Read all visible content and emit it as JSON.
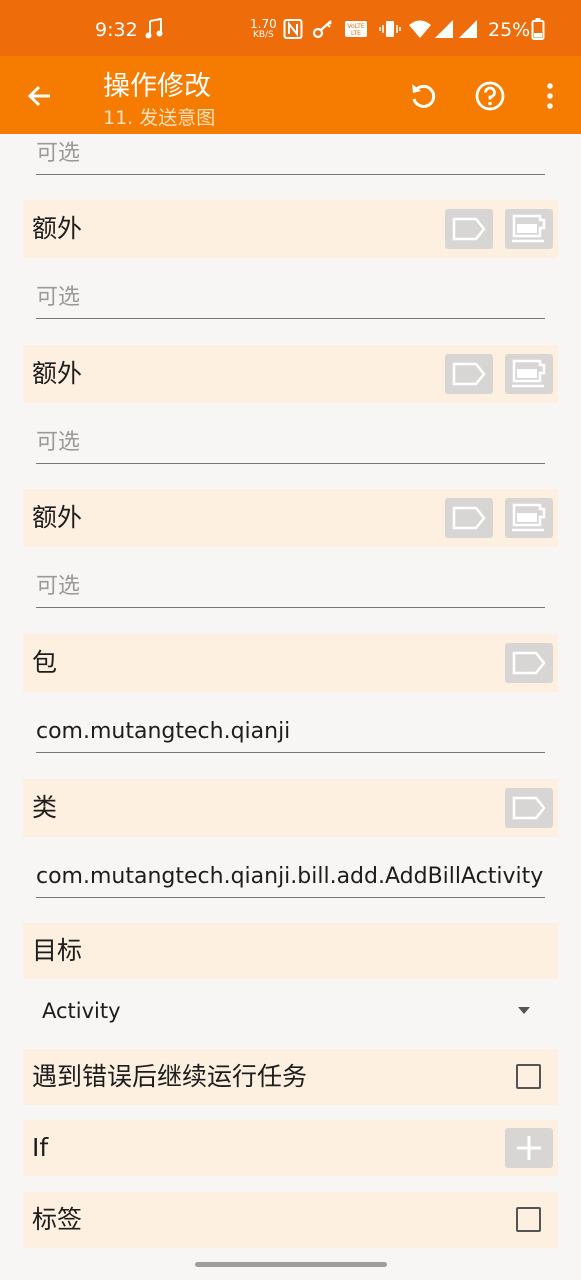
{
  "status": {
    "time": "9:32",
    "net_speed_value": "1.70",
    "net_speed_unit": "KB/S",
    "battery": "25%",
    "icons": [
      "music-note-icon",
      "nfc-icon",
      "key-icon",
      "volte-icon",
      "vibrate-icon",
      "wifi-icon",
      "signal-icon",
      "signal-icon",
      "battery-icon"
    ]
  },
  "toolbar": {
    "title": "操作修改",
    "subtitle": "11. 发送意图",
    "icons": [
      "back-arrow-icon",
      "undo-icon",
      "help-icon",
      "more-vert-icon"
    ]
  },
  "top_field": {
    "placeholder": "可选"
  },
  "extras": [
    {
      "label": "额外",
      "placeholder": "可选"
    },
    {
      "label": "额外",
      "placeholder": "可选"
    },
    {
      "label": "额外",
      "placeholder": "可选"
    }
  ],
  "package": {
    "label": "包",
    "value": "com.mutangtech.qianji"
  },
  "class": {
    "label": "类",
    "value": "com.mutangtech.qianji.bill.add.AddBillActivity"
  },
  "target": {
    "label": "目标",
    "selected": "Activity"
  },
  "continue_on_error": {
    "label": "遇到错误后继续运行任务",
    "checked": false
  },
  "if_row": {
    "label": "If"
  },
  "tag_row": {
    "label": "标签",
    "checked": false
  },
  "colors": {
    "status_bar": "#ef6c0b",
    "toolbar": "#f57c00",
    "header_bg": "#fdf0e0",
    "button_bg": "#d8d6d5"
  }
}
